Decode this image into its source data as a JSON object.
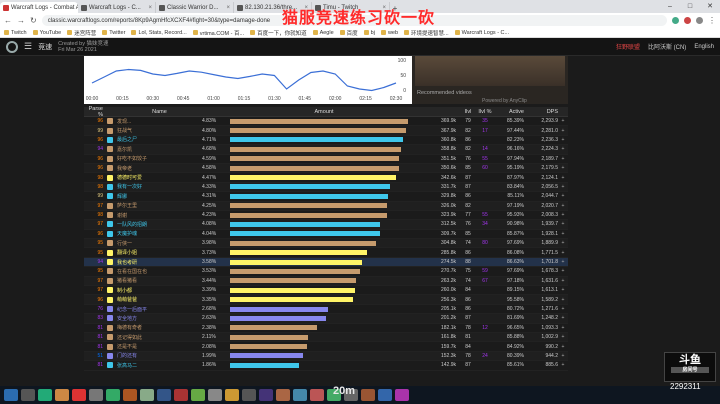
{
  "overlay": {
    "title": "猫服竞速练习砍一砍",
    "bottom_text": "20m",
    "douyu_logo": "斗鱼",
    "douyu_tag": "房间号",
    "room_id": "2292311"
  },
  "tabs": [
    {
      "title": "Warcraft Logs - Combat Anal...",
      "active": true
    },
    {
      "title": "Warcraft Logs - C...",
      "active": false
    },
    {
      "title": "Classic Warrior D...",
      "active": false
    },
    {
      "title": "82.130.21.36/thre...",
      "active": false
    },
    {
      "title": "Timu - Twitch",
      "active": false
    }
  ],
  "address": {
    "url": "classic.warcraftlogs.com/reports/8Kp9AgmHfcXCXF4#fight=30&type=damage-done"
  },
  "bookmarks": [
    "Twitch",
    "YouTube",
    "迷宫阵营",
    "Twitter",
    "Lol, Stats, Record...",
    "vrtima.COM - 百...",
    "百度一下，你就知道",
    "Aegle",
    "百度",
    "bj",
    "web",
    "环境提速智慧...",
    "Warcraft Logs - C..."
  ],
  "site": {
    "brand": "竞速",
    "created_by": "Created by 猫妹竞速",
    "created_date": "Fri Mar 26 2021",
    "user": "比阿沃斯 (CN)",
    "language": "English",
    "guild": "狂野联盟"
  },
  "chart": {
    "xticks": [
      "00:00",
      "00:15",
      "00:30",
      "00:45",
      "01:00",
      "01:15",
      "01:30",
      "01:45",
      "02:00",
      "02:15",
      "02:30"
    ],
    "yright": [
      "100",
      "50",
      "0"
    ]
  },
  "video": {
    "recommended": "Recommended videos",
    "powered": "Powered by AnyClip"
  },
  "table": {
    "headers": {
      "parse": "Parse %",
      "name": "Name",
      "amount": "Amount",
      "ilvl": "Ilvl",
      "ilvlp": "Ilvl %",
      "active": "Active",
      "dps": "DPS"
    },
    "rows": [
      {
        "parse": "96",
        "name": "发现...",
        "pct": "4.83%",
        "amount": "369.9k",
        "ilvl": "79",
        "ilvlp": "35",
        "active": "85.39%",
        "dps": "2,293.9",
        "fill": 1.0,
        "color": "#c69b6d",
        "icon": "#c69b6d"
      },
      {
        "parse": "99",
        "name": "狂战气",
        "pct": "4.80%",
        "amount": "367.9k",
        "ilvl": "82",
        "ilvlp": "17",
        "active": "97.44%",
        "dps": "2,281.0",
        "fill": 0.99,
        "color": "#c69b6d",
        "icon": "#c69b6d"
      },
      {
        "parse": "96",
        "name": "最后之尸",
        "pct": "4.71%",
        "amount": "360.8k",
        "ilvl": "86",
        "ilvlp": "",
        "active": "82.23%",
        "dps": "2,236.3",
        "fill": 0.97,
        "color": "#3fc7eb",
        "icon": "#3fc7eb"
      },
      {
        "parse": "94",
        "name": "嘉尔凯",
        "pct": "4.68%",
        "amount": "358.8k",
        "ilvl": "82",
        "ilvlp": "14",
        "active": "96.16%",
        "dps": "2,224.3",
        "fill": 0.96,
        "color": "#c69b6d",
        "icon": "#c69b6d"
      },
      {
        "parse": "96",
        "name": "好吃不如饺子",
        "pct": "4.59%",
        "amount": "351.5k",
        "ilvl": "76",
        "ilvlp": "55",
        "active": "97.94%",
        "dps": "2,189.7",
        "fill": 0.95,
        "color": "#c69b6d",
        "icon": "#c69b6d"
      },
      {
        "parse": "96",
        "name": "我帝老",
        "pct": "4.58%",
        "amount": "350.6k",
        "ilvl": "85",
        "ilvlp": "60",
        "active": "95.19%",
        "dps": "2,179.5",
        "fill": 0.95,
        "color": "#c69b6d",
        "icon": "#c69b6d"
      },
      {
        "parse": "98",
        "name": "德德时可爱",
        "pct": "4.47%",
        "amount": "342.6k",
        "ilvl": "87",
        "ilvlp": "",
        "active": "87.97%",
        "dps": "2,124.1",
        "fill": 0.93,
        "color": "#fff468",
        "icon": "#fff468"
      },
      {
        "parse": "98",
        "name": "我有一次好",
        "pct": "4.33%",
        "amount": "331.7k",
        "ilvl": "87",
        "ilvlp": "",
        "active": "83.84%",
        "dps": "2,056.5",
        "fill": 0.9,
        "color": "#3fc7eb",
        "icon": "#3fc7eb"
      },
      {
        "parse": "99",
        "name": "辉娜",
        "pct": "4.31%",
        "amount": "329.8k",
        "ilvl": "86",
        "ilvlp": "",
        "active": "85.11%",
        "dps": "2,044.7",
        "fill": 0.89,
        "color": "#3fc7eb",
        "icon": "#3fc7eb"
      },
      {
        "parse": "97",
        "name": "萨尔王里",
        "pct": "4.25%",
        "amount": "326.0k",
        "ilvl": "82",
        "ilvlp": "",
        "active": "97.19%",
        "dps": "2,020.7",
        "fill": 0.88,
        "color": "#c69b6d",
        "icon": "#c69b6d"
      },
      {
        "parse": "98",
        "name": "谢谢",
        "pct": "4.23%",
        "amount": "323.9k",
        "ilvl": "77",
        "ilvlp": "55",
        "active": "95.93%",
        "dps": "2,008.3",
        "fill": 0.88,
        "color": "#c69b6d",
        "icon": "#c69b6d"
      },
      {
        "parse": "97",
        "name": "一队风的招朗",
        "pct": "4.08%",
        "amount": "312.5k",
        "ilvl": "76",
        "ilvlp": "34",
        "active": "90.98%",
        "dps": "1,939.7",
        "fill": 0.84,
        "color": "#3fc7eb",
        "icon": "#3fc7eb"
      },
      {
        "parse": "96",
        "name": "天魔护魂",
        "pct": "4.04%",
        "amount": "309.7k",
        "ilvl": "85",
        "ilvlp": "",
        "active": "85.87%",
        "dps": "1,928.1",
        "fill": 0.84,
        "color": "#3fc7eb",
        "icon": "#3fc7eb"
      },
      {
        "parse": "95",
        "name": "行侠一",
        "pct": "3.98%",
        "amount": "304.8k",
        "ilvl": "74",
        "ilvlp": "80",
        "active": "97.69%",
        "dps": "1,889.9",
        "fill": 0.82,
        "color": "#c69b6d",
        "icon": "#c69b6d"
      },
      {
        "parse": "95",
        "name": "翻译小姐",
        "pct": "3.73%",
        "amount": "285.8k",
        "ilvl": "86",
        "ilvlp": "",
        "active": "86.08%",
        "dps": "1,771.5",
        "fill": 0.77,
        "color": "#fff468",
        "icon": "#fff468"
      },
      {
        "parse": "94",
        "name": "我也考研",
        "pct": "3.58%",
        "amount": "274.5k",
        "ilvl": "88",
        "ilvlp": "",
        "active": "86.63%",
        "dps": "1,701.8",
        "fill": 0.74,
        "color": "#fff468",
        "icon": "#fff468",
        "selected": true
      },
      {
        "parse": "95",
        "name": "在看在国在也",
        "pct": "3.53%",
        "amount": "270.7k",
        "ilvl": "75",
        "ilvlp": "59",
        "active": "97.69%",
        "dps": "1,678.3",
        "fill": 0.73,
        "color": "#c69b6d",
        "icon": "#c69b6d"
      },
      {
        "parse": "97",
        "name": "猪看猪看",
        "pct": "3.44%",
        "amount": "263.2k",
        "ilvl": "74",
        "ilvlp": "67",
        "active": "97.18%",
        "dps": "1,631.6",
        "fill": 0.71,
        "color": "#c69b6d",
        "icon": "#c69b6d"
      },
      {
        "parse": "97",
        "name": "制小都",
        "pct": "3.39%",
        "amount": "260.0k",
        "ilvl": "84",
        "ilvlp": "",
        "active": "89.15%",
        "dps": "1,613.1",
        "fill": 0.7,
        "color": "#fff468",
        "icon": "#fff468"
      },
      {
        "parse": "96",
        "name": "萌萌爸爸",
        "pct": "3.35%",
        "amount": "256.3k",
        "ilvl": "86",
        "ilvlp": "",
        "active": "95.58%",
        "dps": "1,589.2",
        "fill": 0.69,
        "color": "#fff468",
        "icon": "#fff468"
      },
      {
        "parse": "76",
        "name": "纪念一后面平",
        "pct": "2.68%",
        "amount": "205.1k",
        "ilvl": "86",
        "ilvlp": "",
        "active": "80.72%",
        "dps": "1,271.6",
        "fill": 0.55,
        "color": "#8787ed",
        "icon": "#8787ed"
      },
      {
        "parse": "83",
        "name": "安全地方",
        "pct": "2.63%",
        "amount": "201.2k",
        "ilvl": "87",
        "ilvlp": "",
        "active": "81.69%",
        "dps": "1,248.2",
        "fill": 0.54,
        "color": "#8787ed",
        "icon": "#8787ed"
      },
      {
        "parse": "81",
        "name": "梅德有奇者",
        "pct": "2.38%",
        "amount": "182.1k",
        "ilvl": "78",
        "ilvlp": "12",
        "active": "96.65%",
        "dps": "1,093.3",
        "fill": 0.49,
        "color": "#c69b6d",
        "icon": "#c69b6d"
      },
      {
        "parse": "81",
        "name": "还记得如此",
        "pct": "2.11%",
        "amount": "161.8k",
        "ilvl": "81",
        "ilvlp": "",
        "active": "85.88%",
        "dps": "1,002.9",
        "fill": 0.44,
        "color": "#c69b6d",
        "icon": "#c69b6d"
      },
      {
        "parse": "81",
        "name": "还是不是",
        "pct": "2.08%",
        "amount": "159.7k",
        "ilvl": "84",
        "ilvlp": "",
        "active": "84.92%",
        "dps": "990.2",
        "fill": 0.43,
        "color": "#c69b6d",
        "icon": "#c69b6d"
      },
      {
        "parse": "51",
        "name": "门的还有",
        "pct": "1.99%",
        "amount": "152.3k",
        "ilvl": "78",
        "ilvlp": "24",
        "active": "80.39%",
        "dps": "944.2",
        "fill": 0.41,
        "color": "#8787ed",
        "icon": "#8787ed"
      },
      {
        "parse": "81",
        "name": "张高马二",
        "pct": "1.86%",
        "amount": "142.9k",
        "ilvl": "87",
        "ilvlp": "",
        "active": "85.61%",
        "dps": "885.6",
        "fill": 0.39,
        "color": "#3fc7eb",
        "icon": "#3fc7eb"
      }
    ]
  },
  "colors": {
    "parse_legendary": "#e5cc80",
    "parse_epic": "#ff8000",
    "parse_rare": "#a335ee",
    "parse_uncommon": "#0070ff"
  }
}
